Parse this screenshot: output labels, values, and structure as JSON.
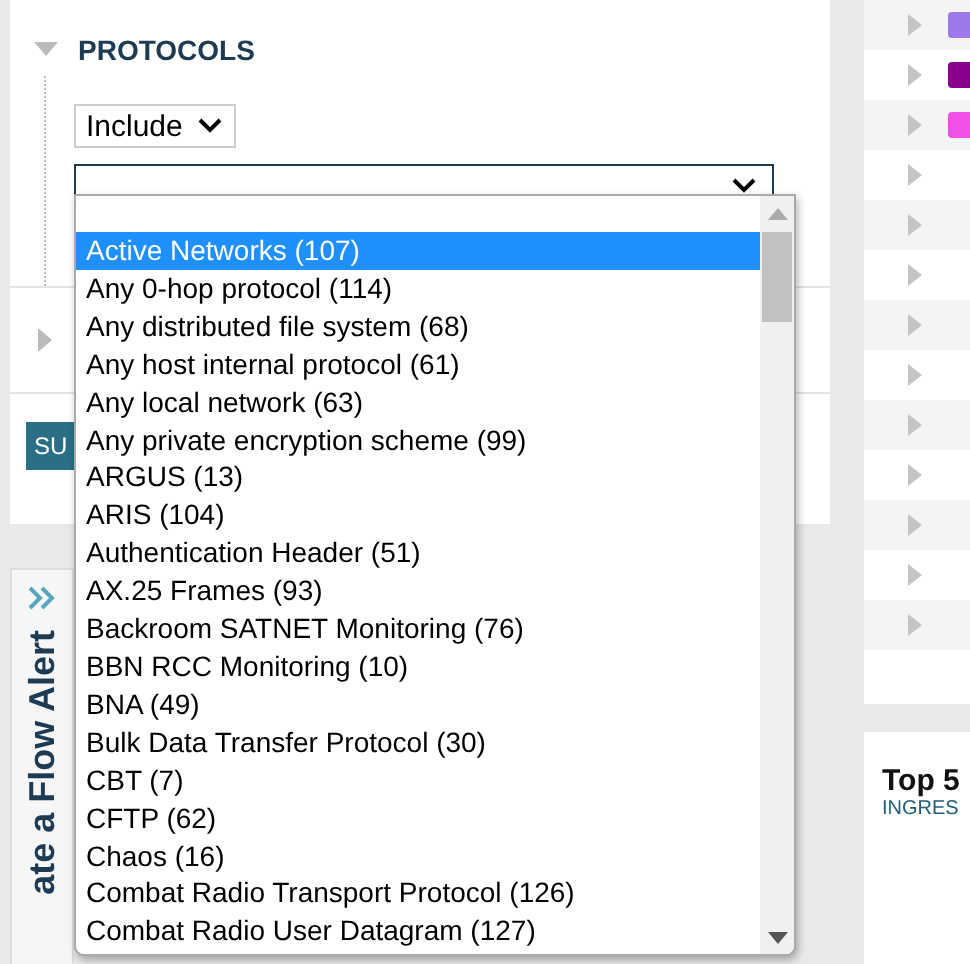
{
  "protocols": {
    "title": "PROTOCOLS",
    "expanded": true,
    "mode_select": {
      "value": "Include"
    },
    "protocol_select": {
      "open": true
    },
    "options": [
      {
        "label": "Active Networks (107)",
        "selected": true
      },
      {
        "label": "Any 0-hop protocol (114)",
        "selected": false
      },
      {
        "label": "Any distributed file system (68)",
        "selected": false
      },
      {
        "label": "Any host internal protocol (61)",
        "selected": false
      },
      {
        "label": "Any local network (63)",
        "selected": false
      },
      {
        "label": "Any private encryption scheme (99)",
        "selected": false
      },
      {
        "label": "ARGUS (13)",
        "selected": false
      },
      {
        "label": "ARIS (104)",
        "selected": false
      },
      {
        "label": "Authentication Header (51)",
        "selected": false
      },
      {
        "label": "AX.25 Frames (93)",
        "selected": false
      },
      {
        "label": "Backroom SATNET Monitoring (76)",
        "selected": false
      },
      {
        "label": "BBN RCC Monitoring (10)",
        "selected": false
      },
      {
        "label": "BNA (49)",
        "selected": false
      },
      {
        "label": "Bulk Data Transfer Protocol (30)",
        "selected": false
      },
      {
        "label": "CBT (7)",
        "selected": false
      },
      {
        "label": "CFTP (62)",
        "selected": false
      },
      {
        "label": "Chaos (16)",
        "selected": false
      },
      {
        "label": "Combat Radio Transport Protocol (126)",
        "selected": false
      },
      {
        "label": "Combat Radio User Datagram (127)",
        "selected": false
      }
    ]
  },
  "submit_button": {
    "label": "SU"
  },
  "flow_alert_tab": {
    "label": "ate a Flow Alert"
  },
  "right_list": {
    "rows": [
      {
        "color": "#9b79e8"
      },
      {
        "color": "#8b008b"
      },
      {
        "color": "#f24fe6"
      },
      {},
      {},
      {},
      {},
      {},
      {},
      {},
      {},
      {},
      {}
    ]
  },
  "top_card": {
    "title": "Top 5",
    "subtitle": "INGRES"
  }
}
